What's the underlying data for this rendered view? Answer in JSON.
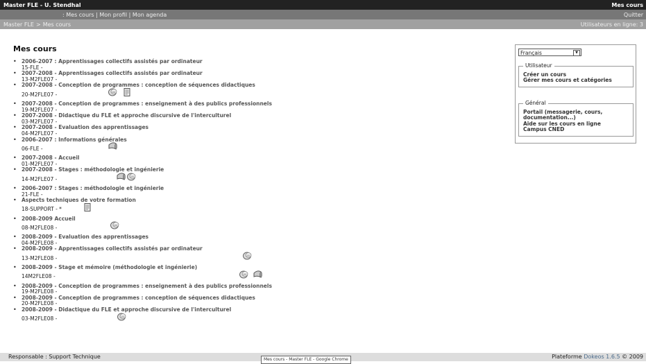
{
  "header": {
    "site_title": "Master FLE - U. Stendhal",
    "right_label": "Mes cours"
  },
  "menu": {
    "links": ": Mes cours | Mon profil | Mon agenda",
    "logout": "Quitter"
  },
  "breadcrumb": {
    "root": "Master FLE",
    "sep": ">",
    "current": "Mes cours",
    "online": "Utilisateurs en ligne: 3"
  },
  "page_title": "Mes cours",
  "courses": [
    {
      "title": "2006-2007 : Apprentissages collectifs assistés par ordinateur",
      "code": "15-FLE -",
      "icons": []
    },
    {
      "title": "2007-2008 - Apprentissages collectifs assistés par ordinateur",
      "code": "13-M2FLE07 -",
      "icons": []
    },
    {
      "title": "2007-2008 - Conception de programmes : conception de séquences didactiques",
      "code": "20-M2FLE07 -",
      "icons": [
        "forum-icon",
        "document-icon"
      ]
    },
    {
      "title": "2007-2008 - Conception de programmes : enseignement à des publics professionnels",
      "code": "19-M2FLE07 -",
      "icons": []
    },
    {
      "title": "2007-2008 - Didactique du FLE et approche discursive de l'interculturel",
      "code": "03-M2FLE07 -",
      "icons": []
    },
    {
      "title": "2007-2008 - Evaluation des apprentissages",
      "code": "04-M2FLE07 -",
      "icons": []
    },
    {
      "title": "2006-2007 : Informations générales",
      "code": "06-FLE -",
      "icons": [
        "announcement-icon"
      ]
    },
    {
      "title": "2007-2008 - Accueil",
      "code": "01-M2FLE07 -",
      "icons": []
    },
    {
      "title": "2007-2008 - Stages : méthodologie et ingénierie",
      "code": "14-M2FLE07 -",
      "icons": [
        "announcement-icon",
        "forum-icon"
      ]
    },
    {
      "title": "2006-2007 : Stages : méthodologie et ingénierie",
      "code": "21-FLE -",
      "icons": []
    },
    {
      "title": "Aspects techniques de votre formation",
      "code": "18-SUPPORT - *",
      "icons": [
        "document-icon"
      ]
    },
    {
      "title": "2008-2009 Accueil",
      "code": "08-M2FLE08 -",
      "icons": [
        "forum-icon"
      ]
    },
    {
      "title": "2008-2009 - Evaluation des apprentissages",
      "code": "04-M2FLE08 -",
      "icons": []
    },
    {
      "title": "2008-2009 - Apprentissages collectifs assistés par ordinateur",
      "code": "13-M2FLE08 -",
      "icons": [
        "forum-icon"
      ]
    },
    {
      "title": "2008-2009 - Stage et mémoire (méthodologie et ingénierie)",
      "code": "14M2FLE08 -",
      "icons": [
        "forum-icon",
        "announcement-icon"
      ]
    },
    {
      "title": "2008-2009 - Conception de programmes : enseignement à des publics professionnels",
      "code": "19-M2FLE08 -",
      "icons": []
    },
    {
      "title": "2008-2009 - Conception de programmes : conception de séquences didactiques",
      "code": "20-M2FLE08 -",
      "icons": []
    },
    {
      "title": "2008-2009 - Didactique du FLE et approche discursive de l'interculturel",
      "code": "03-M2FLE08 -",
      "icons": [
        "forum-icon"
      ]
    }
  ],
  "sidebar": {
    "language": "Français",
    "user_legend": "Utilisateur",
    "user_links": [
      "Créer un cours",
      "Gérer mes cours et catégories"
    ],
    "general_legend": "Général",
    "general_links": [
      "Portail (messagerie, cours, documentation...)",
      "Aide sur les cours en ligne",
      "Campus CNED"
    ]
  },
  "footer": {
    "responsable": "Responsable : Support Technique",
    "platform_prefix": "Plateforme",
    "platform_link": "Dokeos 1.6.5",
    "copyright": "© 2009"
  },
  "tooltip": "Mes cours - Master FLE - Google Chrome"
}
